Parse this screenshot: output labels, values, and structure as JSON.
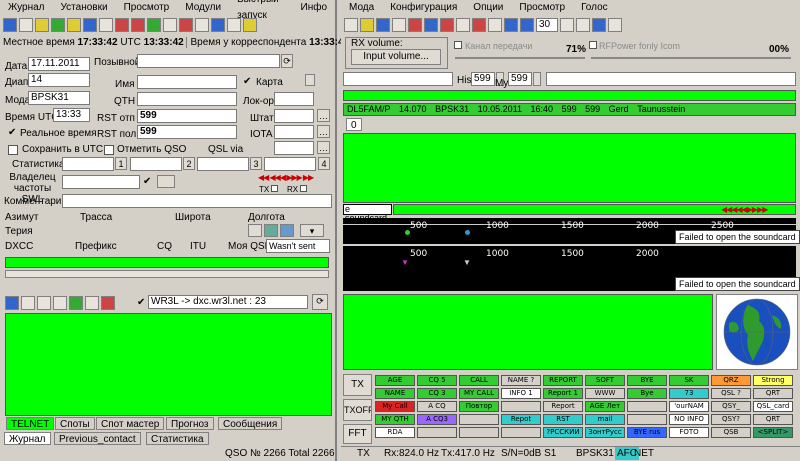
{
  "left": {
    "menu": [
      "Журнал",
      "Установки",
      "Просмотр",
      "Модули",
      "Быстрый запуск",
      "Инфо"
    ],
    "time_bar": {
      "local_label": "Местное время",
      "local": "17:33:42",
      "utc_label": "UTC",
      "utc": "13:33:42",
      "corr_label": "Время у корреспондента",
      "corr": "13:33:42"
    },
    "form": {
      "date_label": "Дата",
      "date": "17.11.2011",
      "band_label": "Диап",
      "band": "14",
      "mode_label": "Мода",
      "mode": "BPSK31",
      "time_utc_label": "Время UTC",
      "time_utc": "13:33",
      "realtime_label": "Реальное время",
      "save_utc_label": "Сохранить в UTC",
      "callsign_label": "Позывной",
      "name_label": "Имя",
      "qth_label": "QTH",
      "rst_sent_label": "RST отп",
      "rst_sent": "599",
      "rst_rcvd_label": "RST пол",
      "rst_rcvd": "599",
      "mark_qso_label": "Отметить QSO",
      "qsl_via_label": "QSL via",
      "map_label": "Карта",
      "locator_label": "Лок-ор",
      "state_label": "Штат",
      "iota_label": "IOTA",
      "stats_label": "Статистика",
      "stat_1": "1",
      "stat_2": "2",
      "stat_3": "3",
      "stat_4": "4",
      "swl_label": "Владелец частоты SWL",
      "tx_label": "TX",
      "rx_label": "RX",
      "comment_label": "Комментарий"
    },
    "info": {
      "azimuth": "Азимут",
      "route": "Трасса",
      "lat": "Широта",
      "lon": "Долгота",
      "territory": "Терия",
      "dxcc": "DXCC",
      "prefix": "Префикс",
      "cq": "CQ",
      "itu": "ITU",
      "my_qsl": "Моя QSL",
      "qsl_value": "Wasn't sent"
    },
    "cluster": {
      "server": "WR3L -> dxc.wr3l.net : 23"
    },
    "tabs_top": [
      "TELNET",
      "Споты",
      "Спот мастер",
      "Прогноз",
      "Сообщения"
    ],
    "tabs_bottom": [
      "Журнал",
      "Previous_contact",
      "Статистика"
    ],
    "status": "QSO № 2266 Total 2266"
  },
  "right": {
    "menu": [
      "Мода",
      "Конфигурация",
      "Опции",
      "Просмотр",
      "Голос"
    ],
    "speed": "30",
    "rx_volume_label": "RX volume:",
    "input_volume_btn": "Input volume...",
    "vol_pct_1": "71%",
    "vol_pct_2": "00%",
    "channel_label": "Канал передачи",
    "rfpower_label": "RFPower  fonly Icom",
    "his_label": "His",
    "his_value": "599",
    "my_label": "My",
    "my_value": "599",
    "qso_line": [
      "DL5FAM/P",
      "14.070",
      "BPSK31",
      "10.05.2011",
      "16:40",
      "599",
      "599",
      "Gerd",
      "Taunusstein"
    ],
    "rx_tab": "0",
    "soundcard_msg": "e soundcard",
    "wf1_error": "Failed to open the soundcard",
    "wf2_error": "Failed to open the soundcard",
    "ticks": [
      "500",
      "1000",
      "1500",
      "2000",
      "2500"
    ],
    "side_buttons": [
      "TX",
      "TXOFF",
      "FFT"
    ],
    "macros": [
      [
        "AGE",
        "CQ 5",
        "CALL",
        "NAME ?",
        "REPORT",
        "SOFT",
        "BYE",
        "SK",
        "QRZ",
        "Strong"
      ],
      [
        "NAME",
        "CQ 3",
        "MY CALL",
        "INFO 1",
        "Report 1",
        "WWW",
        "Bye",
        "73",
        "QSL ?",
        "QRT"
      ],
      [
        "My Call",
        "A CQ",
        "Повтор",
        "",
        "Report",
        "AGE Лет",
        "",
        "'ourNAM",
        "QSY_",
        "QSL_card"
      ],
      [
        "MY QTH",
        "A CQ3",
        "",
        "Repot",
        "RST",
        "mail",
        "",
        "NO INFO",
        "QSY?",
        "QRT"
      ],
      [
        "RDA",
        "",
        "",
        "",
        "?РССКИЙ",
        "ЗонтРусс",
        "BYE rus",
        "FOTO",
        "QSB",
        "<SPLIT>"
      ]
    ],
    "macro_colors": [
      [
        "#33cc33",
        "#33cc33",
        "#33cc33",
        "#d4d0c8",
        "#33cc33",
        "#33cc33",
        "#33cc33",
        "#33cc33",
        "#ff9933",
        "#ffff66"
      ],
      [
        "#33cc33",
        "#33cc33",
        "#33cc33",
        "#ffffff",
        "#33cc33",
        "#d4d0c8",
        "#33cc33",
        "#33cccc",
        "#d4d0c8",
        "#d4d0c8"
      ],
      [
        "#dd2222",
        "#d4d0c8",
        "#33cc33",
        "#d4d0c8",
        "#d4d0c8",
        "#33cc33",
        "#d4d0c8",
        "#ffffff",
        "#d4d0c8",
        "#ffffff"
      ],
      [
        "#33cc33",
        "#9966ff",
        "#d4d0c8",
        "#33cccc",
        "#33cccc",
        "#33cccc",
        "#d4d0c8",
        "#ffffff",
        "#d4d0c8",
        "#d4d0c8"
      ],
      [
        "#ffffff",
        "#d4d0c8",
        "#d4d0c8",
        "#d4d0c8",
        "#33cccc",
        "#33cccc",
        "#3366ff",
        "#ffffff",
        "#d4d0c8",
        "#339966"
      ]
    ],
    "status": {
      "tx": "TX",
      "rx_freq": "Rx:824.0 Hz",
      "tx_freq": "Tx:417.0 Hz",
      "sn": "S/N=0dB S1",
      "mode": "BPSK31",
      "afc": "AFC",
      "net": "NET"
    }
  }
}
